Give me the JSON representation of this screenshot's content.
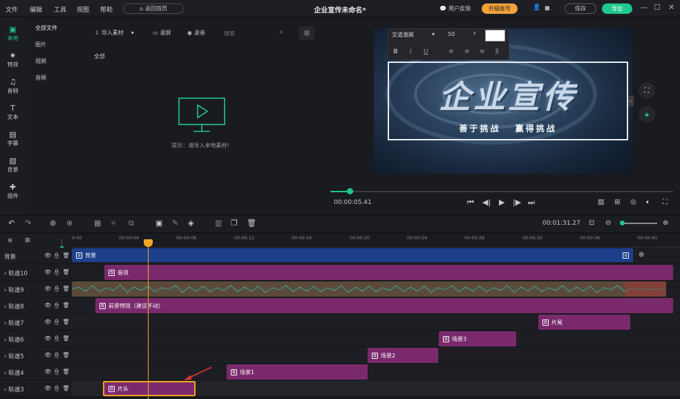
{
  "titlebar": {
    "menus": [
      "文件",
      "编辑",
      "工具",
      "视图",
      "帮助"
    ],
    "home_button": "返回首页",
    "doc_title": "企业宣传未命名*",
    "feedback": "用户反馈",
    "upgrade": "升级账号",
    "save": "保存",
    "export": "导出"
  },
  "left_toolbar": [
    {
      "label": "本地",
      "icon": "folder-icon",
      "active": true
    },
    {
      "label": "特效",
      "icon": "sparkle-icon",
      "active": false
    },
    {
      "label": "音频",
      "icon": "music-icon",
      "active": false
    },
    {
      "label": "文本",
      "icon": "text-icon",
      "active": false
    },
    {
      "label": "字幕",
      "icon": "subtitle-icon",
      "active": false
    },
    {
      "label": "背景",
      "icon": "background-icon",
      "active": false
    },
    {
      "label": "插件",
      "icon": "plugin-icon",
      "active": false
    }
  ],
  "categories": [
    "全部文件",
    "图片",
    "视频",
    "音频"
  ],
  "media": {
    "import": "导入素材",
    "record_screen": "录屏",
    "record_audio": "录音",
    "search_placeholder": "搜索",
    "filter_label": "全部",
    "empty_hint": "提示：请导入本地素材!"
  },
  "text_tool": {
    "font": "文道潮黑",
    "size": "50",
    "color": "#ffffff",
    "formats": [
      "B",
      "I",
      "U"
    ]
  },
  "preview": {
    "title_text": "企业宣传",
    "subtitle_text": "善于挑战 赢得挑战",
    "current_time": "00:00:05.41",
    "progress": 0.06
  },
  "timeline": {
    "total_time": "00:01:31.27",
    "ticks": [
      "0:00",
      "00:00:04",
      "00:00:08",
      "00:00:12",
      "00:00:16",
      "00:00:20",
      "00:00:24",
      "00:00:28",
      "00:00:32",
      "00:00:36",
      "00:00:40"
    ],
    "tracks": [
      {
        "name": "背景"
      },
      {
        "name": "轨道10"
      },
      {
        "name": "轨道9"
      },
      {
        "name": "轨道8"
      },
      {
        "name": "轨道7"
      },
      {
        "name": "轨道6"
      },
      {
        "name": "轨道5"
      },
      {
        "name": "轨道4"
      },
      {
        "name": "轨道3"
      }
    ],
    "clips": {
      "background": "背景",
      "sfx": "音效",
      "foreground": "前景特效（建议不动）",
      "ending": "片尾",
      "scene3": "场景3",
      "scene2": "场景2",
      "scene1": "场景1",
      "opening": "片头"
    }
  }
}
